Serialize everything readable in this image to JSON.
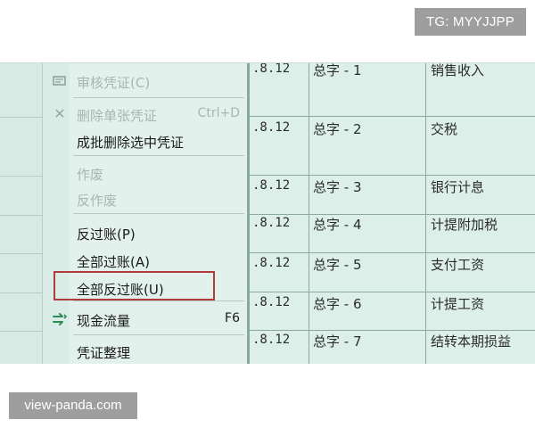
{
  "watermarks": {
    "top": "TG: MYYJJPP",
    "bottom": "view-panda.com"
  },
  "context_menu": {
    "items": [
      {
        "label": "审核凭证(C)",
        "enabled": false,
        "icon": "audit-icon"
      },
      {
        "label": "删除单张凭证",
        "shortcut": "Ctrl+D",
        "enabled": false,
        "icon": "close-icon"
      },
      {
        "label": "成批删除选中凭证",
        "enabled": true
      },
      {
        "label": "作废",
        "enabled": false
      },
      {
        "label": "反作废",
        "enabled": false
      },
      {
        "label": "反过账(P)",
        "enabled": true
      },
      {
        "label": "全部过账(A)",
        "enabled": true
      },
      {
        "label": "全部反过账(U)",
        "enabled": true,
        "highlighted": true
      },
      {
        "label": "现金流量",
        "shortcut": "F6",
        "enabled": true,
        "icon": "cash-flow-icon"
      },
      {
        "label": "凭证整理",
        "enabled": true
      }
    ],
    "icon_colors": {
      "cash_flow": "#2e8b57",
      "audit": "#7f8f8a"
    },
    "highlight_color": "#b23a3a"
  },
  "vouchers": {
    "rows": [
      {
        "date": ".8.12",
        "number": "总字 - 1",
        "summary": "销售收入"
      },
      {
        "date": ".8.12",
        "number": "总字 - 2",
        "summary": "交税"
      },
      {
        "date": ".8.12",
        "number": "总字 - 3",
        "summary": "银行计息"
      },
      {
        "date": ".8.12",
        "number": "总字 - 4",
        "summary": "计提附加税"
      },
      {
        "date": ".8.12",
        "number": "总字 - 5",
        "summary": "支付工资"
      },
      {
        "date": ".8.12",
        "number": "总字 - 6",
        "summary": "计提工资"
      },
      {
        "date": ".8.12",
        "number": "总字 - 7",
        "summary": "结转本期损益"
      }
    ]
  }
}
